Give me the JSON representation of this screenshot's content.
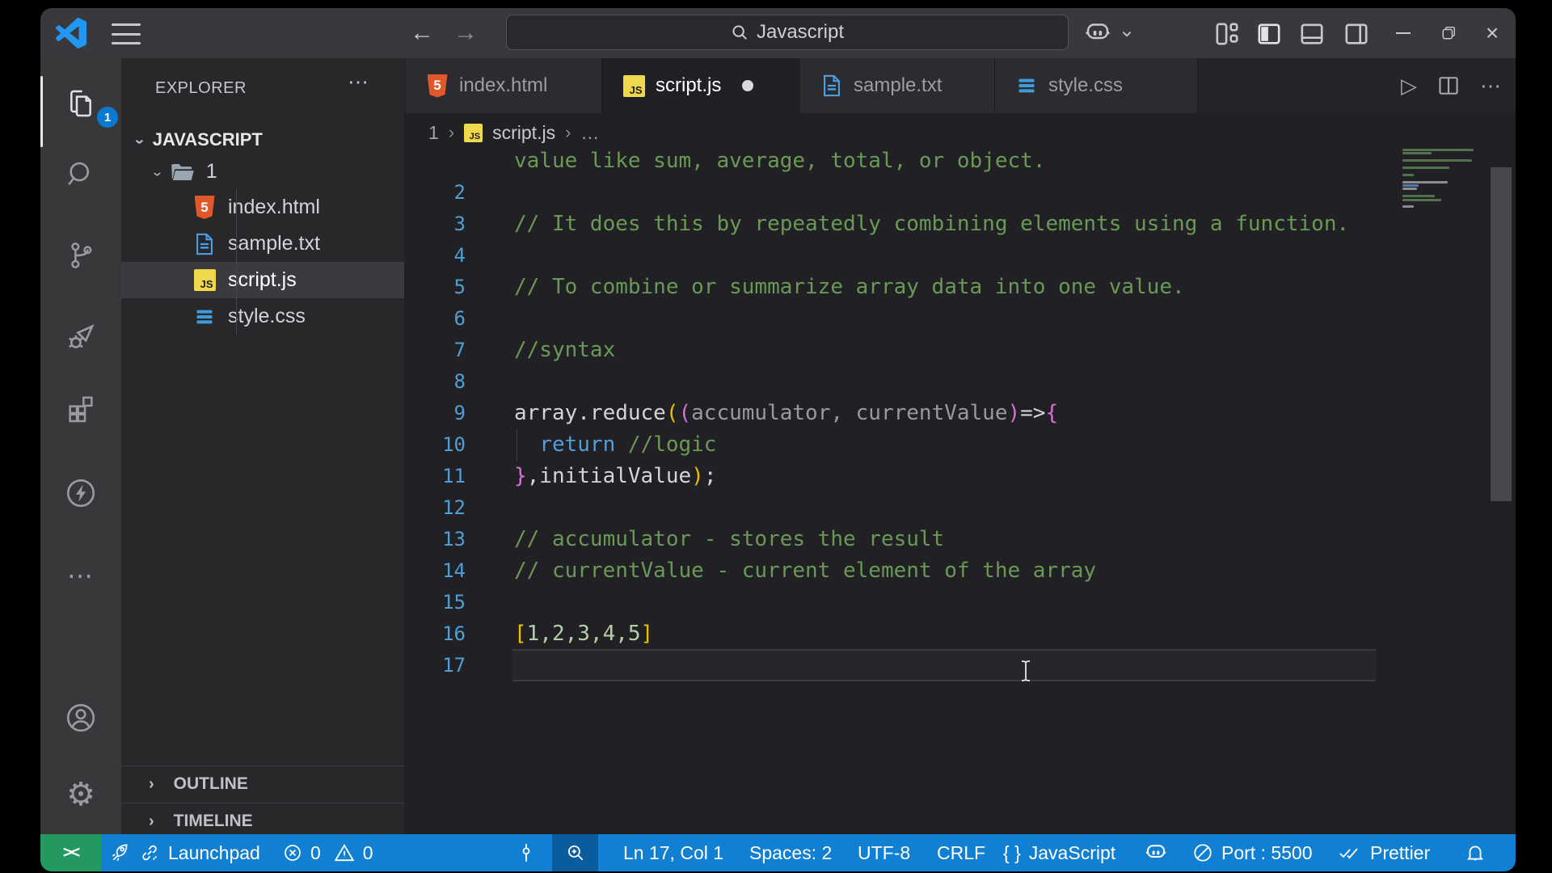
{
  "titlebar": {
    "search": "Javascript"
  },
  "glyphs": {
    "back": "←",
    "forward": "→",
    "more": "⋯",
    "run": "▷",
    "gear": "⚙",
    "close": "×",
    "chevron_right": "›",
    "chevron_down": "˅",
    "chevron_side": "›",
    "remote": "><",
    "braces": "{ }",
    "dots": "⋯"
  },
  "activity": {
    "badge": "1"
  },
  "explorer": {
    "header": "EXPLORER",
    "workspace": "JAVASCRIPT",
    "folder": "1",
    "files": [
      {
        "name": "index.html",
        "icon": "html",
        "selected": false
      },
      {
        "name": "sample.txt",
        "icon": "txt",
        "selected": false
      },
      {
        "name": "script.js",
        "icon": "js",
        "selected": true
      },
      {
        "name": "style.css",
        "icon": "css",
        "selected": false
      }
    ],
    "sections": [
      {
        "label": "OUTLINE"
      },
      {
        "label": "TIMELINE"
      }
    ]
  },
  "tabs": [
    {
      "label": "index.html",
      "icon": "html",
      "active": false,
      "modified": false
    },
    {
      "label": "script.js",
      "icon": "js",
      "active": true,
      "modified": true
    },
    {
      "label": "sample.txt",
      "icon": "txt",
      "active": false,
      "modified": false
    },
    {
      "label": "style.css",
      "icon": "css",
      "active": false,
      "modified": false
    }
  ],
  "breadcrumb": {
    "folder": "1",
    "file": "script.js",
    "symbol": "…"
  },
  "code": {
    "colors": {
      "comment": "#6A9955",
      "keyword": "#569CD6",
      "text": "#d4d4d4",
      "param": "#999aa1",
      "p1": "#e8c100",
      "p2": "#d670d6",
      "num": "#b5cea8"
    },
    "rows": [
      {
        "num": "",
        "tokens": [
          [
            "value like sum, average, total, or object.",
            "comment"
          ]
        ]
      },
      {
        "num": "2",
        "tokens": []
      },
      {
        "num": "3",
        "tokens": [
          [
            "// It does this by repeatedly combining elements using a function.",
            "comment"
          ]
        ]
      },
      {
        "num": "4",
        "tokens": []
      },
      {
        "num": "5",
        "tokens": [
          [
            "// To combine or summarize array data into one value.",
            "comment"
          ]
        ]
      },
      {
        "num": "6",
        "tokens": []
      },
      {
        "num": "7",
        "tokens": [
          [
            "//syntax",
            "comment"
          ]
        ]
      },
      {
        "num": "8",
        "tokens": []
      },
      {
        "num": "9",
        "tokens": [
          [
            "array.reduce",
            "text"
          ],
          [
            "(",
            "p1"
          ],
          [
            "(",
            "p2"
          ],
          [
            "accumulator, currentValue",
            "param"
          ],
          [
            ")",
            "p2"
          ],
          [
            "=>",
            "text"
          ],
          [
            "{",
            "p2"
          ]
        ]
      },
      {
        "num": "10",
        "tokens": [
          [
            "  ",
            "text"
          ],
          [
            "return",
            "keyword"
          ],
          [
            " ",
            "text"
          ],
          [
            "//logic",
            "comment"
          ]
        ],
        "guide": true
      },
      {
        "num": "11",
        "tokens": [
          [
            "}",
            "p2"
          ],
          [
            ",initialValue",
            "text"
          ],
          [
            ")",
            "p1"
          ],
          [
            ";",
            "text"
          ]
        ]
      },
      {
        "num": "12",
        "tokens": []
      },
      {
        "num": "13",
        "tokens": [
          [
            "// accumulator - stores the result",
            "comment"
          ]
        ]
      },
      {
        "num": "14",
        "tokens": [
          [
            "// currentValue - current element of the array",
            "comment"
          ]
        ]
      },
      {
        "num": "15",
        "tokens": []
      },
      {
        "num": "16",
        "tokens": [
          [
            "[",
            "p1"
          ],
          [
            "1,2,3,4,5",
            "num"
          ],
          [
            "]",
            "p1"
          ]
        ]
      },
      {
        "num": "17",
        "tokens": [],
        "current": true
      }
    ]
  },
  "minimap": {
    "colors": {
      "c": "#54714f",
      "w": "#8b8b90",
      "b": "#4d7ca8"
    },
    "rows": [
      [
        88,
        "c"
      ],
      [
        36,
        "c"
      ],
      [
        0,
        ""
      ],
      [
        86,
        "c"
      ],
      [
        0,
        ""
      ],
      [
        58,
        "c"
      ],
      [
        0,
        ""
      ],
      [
        14,
        "c"
      ],
      [
        0,
        ""
      ],
      [
        56,
        "w"
      ],
      [
        20,
        "b"
      ],
      [
        18,
        "w"
      ],
      [
        0,
        ""
      ],
      [
        40,
        "c"
      ],
      [
        48,
        "c"
      ],
      [
        0,
        ""
      ],
      [
        14,
        "w"
      ],
      [
        0,
        ""
      ]
    ]
  },
  "status": {
    "launchpad": "Launchpad",
    "errors": "0",
    "warnings": "0",
    "cursor": "Ln 17, Col 1",
    "indent": "Spaces: 2",
    "encoding": "UTF-8",
    "eol": "CRLF",
    "language": "JavaScript",
    "port": "Port : 5500",
    "formatter": "Prettier"
  }
}
